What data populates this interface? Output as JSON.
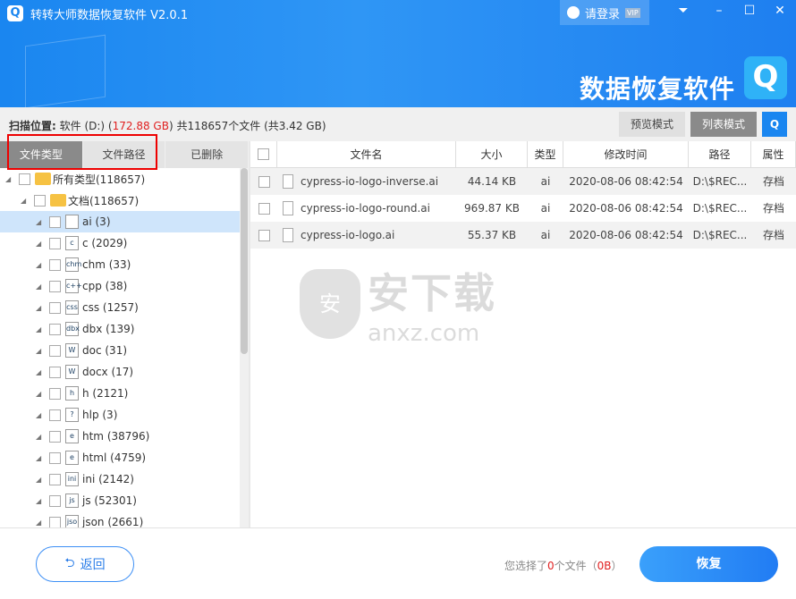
{
  "app": {
    "title": "转转大师数据恢复软件 V2.0.1",
    "login": "请登录",
    "vip": "VIP",
    "brand": "数据恢复软件"
  },
  "scan": {
    "label": "扫描位置:",
    "drive": "软件 (D:)",
    "size": "172.88 GB",
    "total": "共118657个文件",
    "total_size": "(共3.42 GB)",
    "preview_mode": "预览模式",
    "list_mode": "列表模式"
  },
  "tabs": [
    {
      "label": "文件类型",
      "active": true
    },
    {
      "label": "文件路径"
    },
    {
      "label": "已删除"
    }
  ],
  "tree": [
    {
      "label": "所有类型(118657)",
      "level": 0,
      "icon": "folder"
    },
    {
      "label": "文档(118657)",
      "level": 1,
      "icon": "folder"
    },
    {
      "label": "ai (3)",
      "level": 2,
      "icon": "file",
      "selected": true
    },
    {
      "label": "c (2029)",
      "level": 2,
      "icon": "c"
    },
    {
      "label": "chm (33)",
      "level": 2,
      "icon": "chm"
    },
    {
      "label": "cpp (38)",
      "level": 2,
      "icon": "c++"
    },
    {
      "label": "css (1257)",
      "level": 2,
      "icon": "css"
    },
    {
      "label": "dbx (139)",
      "level": 2,
      "icon": "dbx"
    },
    {
      "label": "doc (31)",
      "level": 2,
      "icon": "W"
    },
    {
      "label": "docx (17)",
      "level": 2,
      "icon": "W"
    },
    {
      "label": "h (2121)",
      "level": 2,
      "icon": "h"
    },
    {
      "label": "hlp (3)",
      "level": 2,
      "icon": "?"
    },
    {
      "label": "htm (38796)",
      "level": 2,
      "icon": "e"
    },
    {
      "label": "html (4759)",
      "level": 2,
      "icon": "e"
    },
    {
      "label": "ini (2142)",
      "level": 2,
      "icon": "ini"
    },
    {
      "label": "js (52301)",
      "level": 2,
      "icon": "js"
    },
    {
      "label": "json (2661)",
      "level": 2,
      "icon": "json"
    }
  ],
  "table": {
    "headers": [
      "文件名",
      "大小",
      "类型",
      "修改时间",
      "路径",
      "属性"
    ],
    "rows": [
      {
        "name": "cypress-io-logo-inverse.ai",
        "size": "44.14 KB",
        "type": "ai",
        "time": "2020-08-06 08:42:54",
        "path": "D:\\$REC...",
        "attr": "存档"
      },
      {
        "name": "cypress-io-logo-round.ai",
        "size": "969.87 KB",
        "type": "ai",
        "time": "2020-08-06 08:42:54",
        "path": "D:\\$REC...",
        "attr": "存档"
      },
      {
        "name": "cypress-io-logo.ai",
        "size": "55.37 KB",
        "type": "ai",
        "time": "2020-08-06 08:42:54",
        "path": "D:\\$REC...",
        "attr": "存档"
      }
    ]
  },
  "watermark": {
    "text": "安下载",
    "sub": "anxz.com"
  },
  "footer": {
    "back": "返回",
    "sel_prefix": "您选择了",
    "sel_count": "0",
    "sel_mid": "个文件（",
    "sel_size": "0B",
    "sel_suffix": "）",
    "recover": "恢复"
  }
}
